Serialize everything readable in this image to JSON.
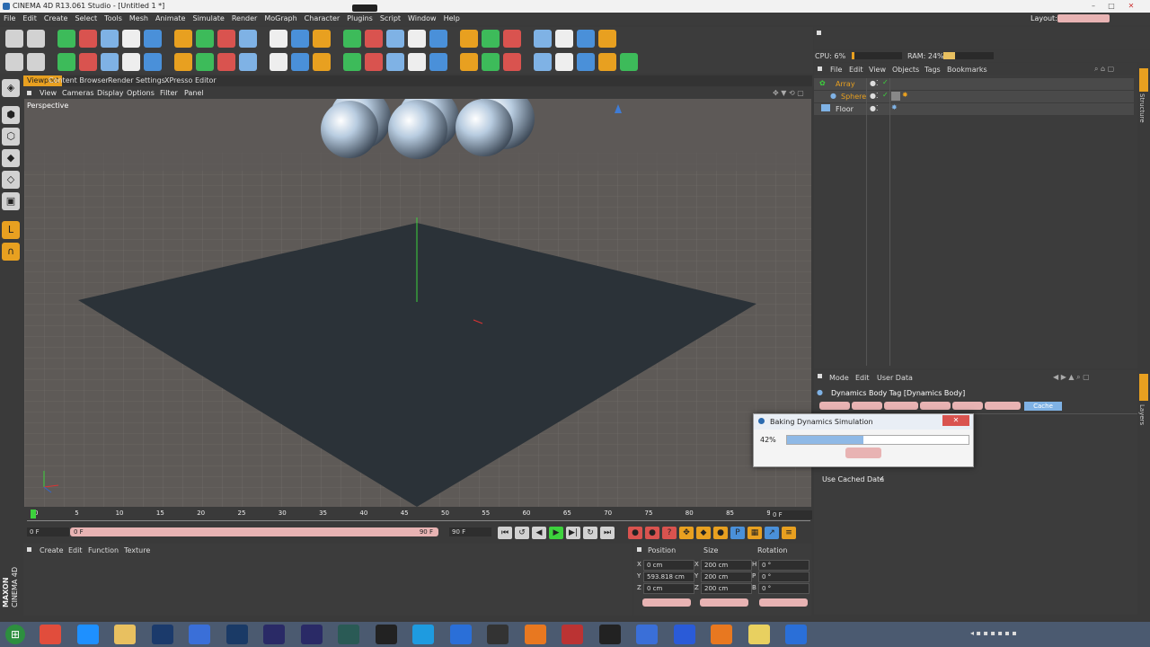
{
  "window": {
    "title": "CINEMA 4D R13.061 Studio - [Untitled 1 *]",
    "layout_label": "Layout:"
  },
  "menu": [
    "File",
    "Edit",
    "Create",
    "Select",
    "Tools",
    "Mesh",
    "Animate",
    "Simulate",
    "Render",
    "MoGraph",
    "Character",
    "Plugins",
    "Script",
    "Window",
    "Help"
  ],
  "toolbar_row1_icons": [
    "undo-icon",
    "redo-icon",
    "select-arrow-icon",
    "move-icon",
    "scale-icon",
    "rotate-icon",
    "live-select-icon",
    "x-axis-icon",
    "y-axis-icon",
    "z-axis-icon",
    "coordinate-system-icon",
    "render-view-icon",
    "render-picture-icon",
    "edit-render-settings-icon",
    "cube-icon",
    "spline-pen-icon",
    "nurbs-icon",
    "array-icon",
    "deformer-icon",
    "floor-icon",
    "camera-icon",
    "light-icon",
    "scene-icon-1",
    "scene-icon-2",
    "scene-icon-3",
    "scene-icon-4"
  ],
  "toolbar_row2_icons": [
    "make-editable-icon",
    "model-mode-icon",
    "save-icon",
    "save-as-icon",
    "record-icon",
    "autokey-icon",
    "keyframe-icon",
    "timeline-icon",
    "hair-icon",
    "sculpt-icon",
    "mograph-icon",
    "character-icon",
    "bodypaint-icon",
    "text-icon",
    "render-region-icon",
    "interactive-render-icon",
    "sound-icon",
    "snap-icon",
    "workplane-icon",
    "grid-icon",
    "axis-icon",
    "deform-icon",
    "ball-icon",
    "dynamics-icon",
    "bhodi-icon",
    "pyro-icon",
    "vray-icon"
  ],
  "status": {
    "cpu": "CPU: 6%",
    "ram": "RAM: 24%"
  },
  "tabs": [
    "Viewport",
    "Content Browser",
    "Render Settings",
    "XPresso Editor"
  ],
  "viewport_menu": [
    "View",
    "Cameras",
    "Display",
    "Options",
    "Filter",
    "Panel"
  ],
  "viewport_label": "Perspective",
  "timeline": {
    "ticks": [
      "0",
      "5",
      "10",
      "15",
      "20",
      "25",
      "30",
      "35",
      "40",
      "45",
      "50",
      "55",
      "60",
      "65",
      "70",
      "75",
      "80",
      "85",
      "90"
    ],
    "current_frame_field": "0 F",
    "start_field": "0 F",
    "scrub_start": "0 F",
    "scrub_end": "90 F",
    "end_field": "90 F",
    "right_field": "0 F"
  },
  "material_menu": [
    "Create",
    "Edit",
    "Function",
    "Texture"
  ],
  "brand": {
    "line1": "MAXON",
    "line2": "CINEMA 4D"
  },
  "coords": {
    "headers": [
      "Position",
      "Size",
      "Rotation"
    ],
    "rows": [
      {
        "axis": "X",
        "pos": "0 cm",
        "size_axis": "X",
        "size": "200 cm",
        "rot_axis": "H",
        "rot": "0 °"
      },
      {
        "axis": "Y",
        "pos": "593.818 cm",
        "size_axis": "Y",
        "size": "200 cm",
        "rot_axis": "P",
        "rot": "0 °"
      },
      {
        "axis": "Z",
        "pos": "0 cm",
        "size_axis": "Z",
        "size": "200 cm",
        "rot_axis": "B",
        "rot": "0 °"
      }
    ]
  },
  "objects_menu": [
    "File",
    "Edit",
    "View",
    "Objects",
    "Tags",
    "Bookmarks"
  ],
  "objects": [
    {
      "name": "Array",
      "color": "#e8a020"
    },
    {
      "name": "Sphere",
      "color": "#e8a020"
    },
    {
      "name": "Floor",
      "color": "#e0e0e0"
    }
  ],
  "attr_menu": [
    "Mode",
    "Edit",
    "User Data"
  ],
  "attr_title": "Dynamics Body Tag [Dynamics Body]",
  "attr_tabs": [
    "Cache"
  ],
  "attr_field": {
    "label": "Use Cached Data",
    "value": "✓"
  },
  "dialog": {
    "title": "Baking Dynamics Simulation",
    "progress_label": "42%",
    "progress": 0.42
  },
  "side_labels": {
    "objects": "Structure",
    "attrs": "Layers"
  },
  "accent": "#7fb2e5"
}
